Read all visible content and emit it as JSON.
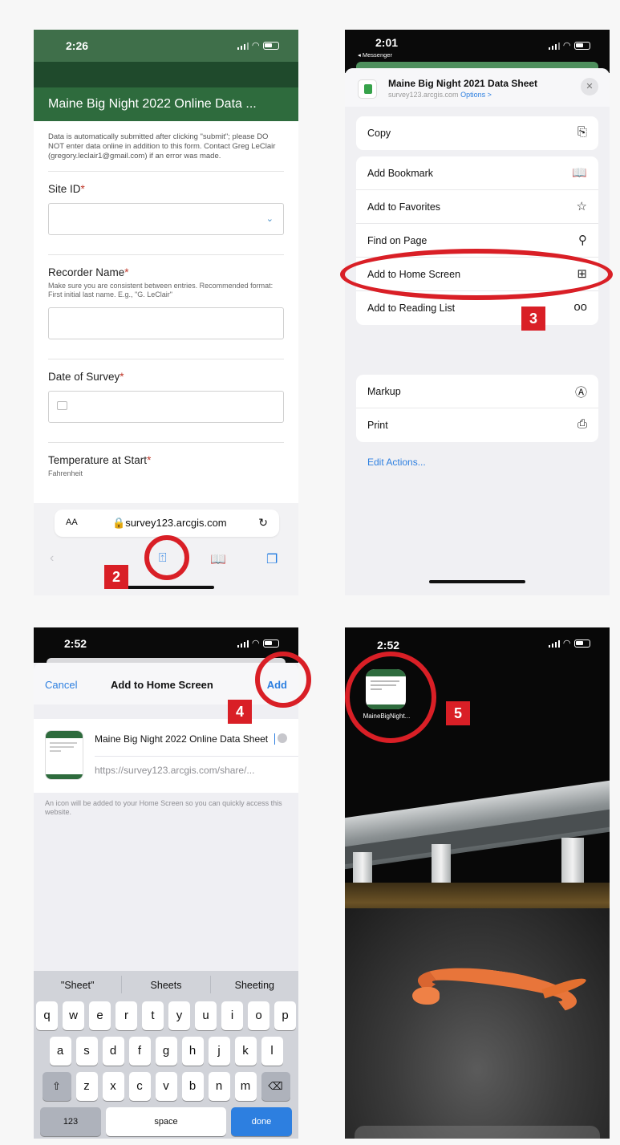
{
  "phone1": {
    "status_time": "2:26",
    "title": "Maine Big Night 2022 Online Data ...",
    "info": "Data is automatically submitted after clicking \"submit\"; please DO NOT enter data online in addition to this form. Contact Greg LeClair (gregory.leclair1@gmail.com) if an error was made.",
    "site_id_label": "Site ID",
    "recorder_label": "Recorder Name",
    "recorder_help": "Make sure you are consistent between entries. Recommended format: First initial last name. E.g., \"G. LeClair\"",
    "date_label": "Date of Survey",
    "temp_label": "Temperature at Start",
    "temp_help": "Fahrenheit",
    "required_mark": "*",
    "url_aa": "AA",
    "url": "survey123.arcgis.com",
    "badge": "2"
  },
  "phone2": {
    "status_time": "2:01",
    "status_back": "◂ Messenger",
    "header_title": "Maine Big Night 2021 Data Sheet",
    "header_domain": "survey123.arcgis.com",
    "header_options": "Options >",
    "actions": {
      "copy": "Copy",
      "add_bookmark": "Add Bookmark",
      "add_favorites": "Add to Favorites",
      "find_on_page": "Find on Page",
      "add_home_screen": "Add to Home Screen",
      "add_reading_list": "Add to Reading List",
      "markup": "Markup",
      "print": "Print"
    },
    "edit_actions": "Edit Actions...",
    "badge": "3"
  },
  "phone3": {
    "status_time": "2:52",
    "cancel": "Cancel",
    "title": "Add to Home Screen",
    "add": "Add",
    "name_value": "Maine Big Night 2022 Online Data Sheet",
    "url_value": "https://survey123.arcgis.com/share/...",
    "note": "An icon will be added to your Home Screen so you can quickly access this website.",
    "suggestions": [
      "\"Sheet\"",
      "Sheets",
      "Sheeting"
    ],
    "row1": [
      "q",
      "w",
      "e",
      "r",
      "t",
      "y",
      "u",
      "i",
      "o",
      "p"
    ],
    "row2": [
      "a",
      "s",
      "d",
      "f",
      "g",
      "h",
      "j",
      "k",
      "l"
    ],
    "row3": [
      "z",
      "x",
      "c",
      "v",
      "b",
      "n",
      "m"
    ],
    "key_123": "123",
    "key_space": "space",
    "key_done": "done",
    "badge": "4"
  },
  "phone4": {
    "status_time": "2:52",
    "clip_label": "MaineBigNight...",
    "badge": "5"
  },
  "colors": {
    "annotation_red": "#d91f26",
    "arcgis_green": "#2e6b3d",
    "ios_blue": "#2d7fe0"
  }
}
